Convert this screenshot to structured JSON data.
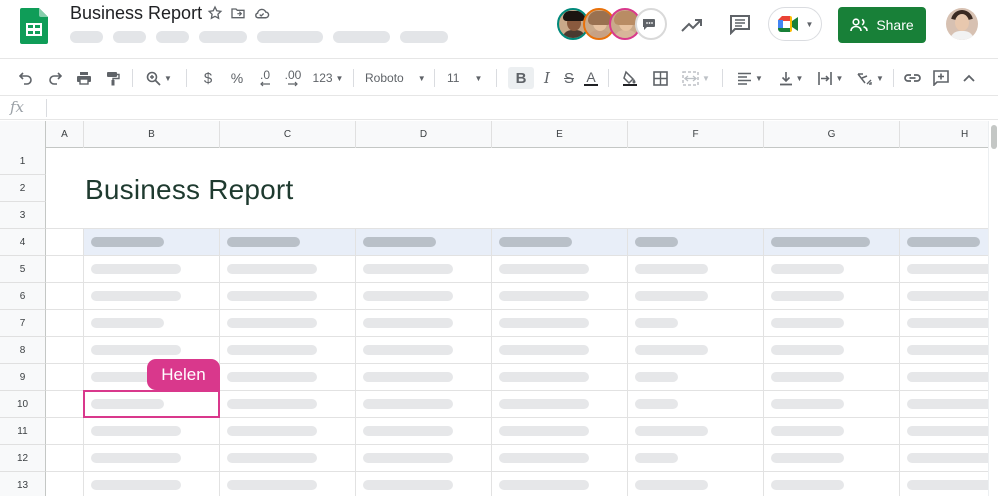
{
  "app": {
    "title": "Business Report",
    "share_label": "Share"
  },
  "toolbar": {
    "number_format_label": "123",
    "font_name": "Roboto",
    "font_size": "11",
    "decimal_decrease_label": ".0",
    "decimal_increase_label": ".00",
    "currency_label": "$",
    "percent_label": "%"
  },
  "formula_bar": {
    "fx_label": "fx"
  },
  "sheet": {
    "columns": [
      "A",
      "B",
      "C",
      "D",
      "E",
      "F",
      "G",
      "H"
    ],
    "rows": [
      "1",
      "2",
      "3",
      "4",
      "5",
      "6",
      "7",
      "8",
      "9",
      "10",
      "11",
      "12",
      "13"
    ],
    "report_title": "Business Report"
  },
  "collaborator_cursor": {
    "name": "Helen",
    "cell": "B10",
    "color": "#d9388c"
  },
  "colors": {
    "share_button": "#188038",
    "header_band": "#e8eef8",
    "cursor": "#d9388c",
    "title_text": "#1e3a2f"
  }
}
